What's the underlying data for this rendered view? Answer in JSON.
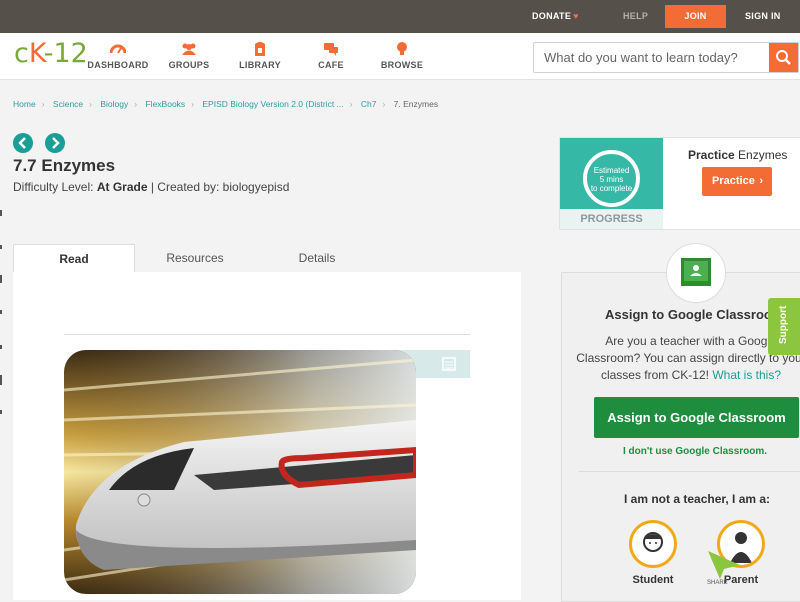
{
  "topbar": {
    "donate": "DONATE",
    "help": "HELP",
    "join": "JOIN",
    "signin": "SIGN IN"
  },
  "header": {
    "logo": {
      "c": "c",
      "k": "K",
      "dash": "-",
      "num": "12"
    },
    "nav": [
      "DASHBOARD",
      "GROUPS",
      "LIBRARY",
      "CAFE",
      "BROWSE"
    ],
    "search_placeholder": "What do you want to learn today?"
  },
  "breadcrumb": [
    "Home",
    "Science",
    "Biology",
    "FlexBooks",
    "EPISD Biology Version 2.0 (District ...",
    "Ch7",
    "7. Enzymes"
  ],
  "page": {
    "title": "7.7 Enzymes",
    "difficulty_label": "Difficulty Level:",
    "difficulty_value": "At Grade",
    "created_by": "| Created by: biologyepisd"
  },
  "tabs": [
    "Read",
    "Resources",
    "Details"
  ],
  "practice": {
    "estimated_line1": "Estimated",
    "estimated_line2": "5 mins",
    "estimated_line3": "to complete",
    "progress_label": "PROGRESS",
    "title_bold": "Practice",
    "title_rest": "Enzymes",
    "button": "Practice"
  },
  "google_classroom": {
    "title": "Assign to Google Classroom",
    "text": "Are you a teacher with a Google Classroom? You can assign directly to your classes from CK-12!",
    "link": "What is this?",
    "button": "Assign to Google Classroom",
    "no_use": "I don't use Google Classroom.",
    "iam": "I am not a teacher, I am a:",
    "student": "Student",
    "parent": "Parent"
  },
  "support": "Support",
  "share": "SHARE",
  "colors": {
    "orange": "#f36c35",
    "teal": "#1a9e96",
    "green": "#1e8e3e",
    "topbar": "#55504a"
  }
}
